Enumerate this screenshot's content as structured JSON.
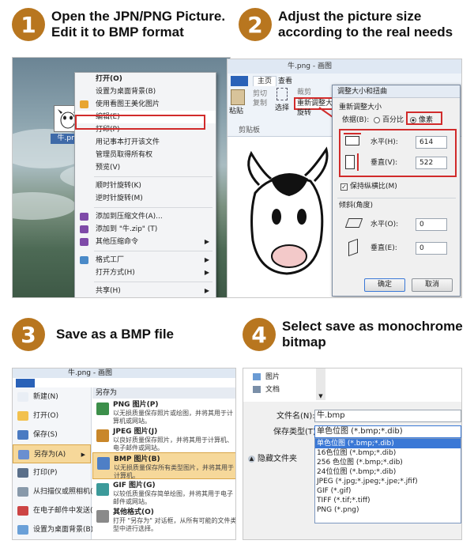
{
  "steps": [
    {
      "number": "1",
      "title_line1": "Open the JPN/PNG Picture.",
      "title_line2": "Edit it to BMP format"
    },
    {
      "number": "2",
      "title_line1": "Adjust the picture size",
      "title_line2": "according to the real needs"
    },
    {
      "number": "3",
      "title_line1": "Save as a BMP file",
      "title_line2": ""
    },
    {
      "number": "4",
      "title_line1": "Select save as monochrome",
      "title_line2": "bitmap"
    }
  ],
  "panel1": {
    "file_label": "牛.png",
    "menu": [
      {
        "label": "打开(O)",
        "bold": true
      },
      {
        "label": "设置为桌面背景(B)"
      },
      {
        "label": "使用看图王美化图片",
        "icon": "#e8a530"
      },
      {
        "label": "编辑(E)",
        "highlight": true
      },
      {
        "label": "打印(P)"
      },
      {
        "label": "用记事本打开该文件"
      },
      {
        "label": "管理员取得所有权"
      },
      {
        "label": "预览(V)"
      },
      {
        "sep": true
      },
      {
        "label": "顺时针旋转(K)"
      },
      {
        "label": "逆时针旋转(M)"
      },
      {
        "sep": true
      },
      {
        "label": "添加到压缩文件(A)...",
        "icon": "#7e4aa8"
      },
      {
        "label": "添加到 \"牛.zip\" (T)",
        "icon": "#7e4aa8"
      },
      {
        "label": "其他压缩命令",
        "icon": "#7e4aa8",
        "arrow": true
      },
      {
        "sep": true
      },
      {
        "label": "格式工厂",
        "icon": "#4a8ac8",
        "arrow": true
      },
      {
        "label": "打开方式(H)",
        "arrow": true
      },
      {
        "sep": true
      },
      {
        "label": "共享(H)",
        "arrow": true
      }
    ]
  },
  "panel2": {
    "window_title": "牛.png - 画图",
    "tab_home": "主页",
    "tab_view": "查看",
    "paste": "粘贴",
    "cut": "剪切",
    "copy": "复制",
    "clipboard": "剪贴板",
    "select": "选择",
    "crop": "裁剪",
    "resize": "重新调整大小",
    "rotate": "旋转",
    "dialog_title": "调整大小和扭曲",
    "resize_group": "重新调整大小",
    "by_label": "依据(B):",
    "percent": "百分比",
    "pixels": "像素",
    "horizontal": "水平(H):",
    "vertical": "垂直(V):",
    "h_value": "614",
    "v_value": "522",
    "keep_ratio": "保持纵横比(M)",
    "skew_group": "倾斜(角度)",
    "skew_h": "水平(O):",
    "skew_v": "垂直(E):",
    "skew_h_value": "0",
    "skew_v_value": "0",
    "ok": "确定",
    "cancel": "取消"
  },
  "panel3": {
    "window_title": "牛.png - 画图",
    "left_items": [
      "新建(N)",
      "打开(O)",
      "保存(S)",
      "另存为(A)",
      "打印(P)",
      "从扫描仪或照相机(M)",
      "在电子邮件中发送(D)",
      "设置为桌面背景(B)"
    ],
    "save_as_header": "另存为",
    "right_items": [
      {
        "title": "PNG 图片(P)",
        "desc": "以无损质量保存照片或绘图，并将其用于计算机或网站。"
      },
      {
        "title": "JPEG 图片(J)",
        "desc": "以良好质量保存照片，并将其用于计算机、电子邮件或网站。"
      },
      {
        "title": "BMP 图片(B)",
        "desc": "以无损质量保存所有类型图片，并将其用于计算机。"
      },
      {
        "title": "GIF 图片(G)",
        "desc": "以较低质量保存简单绘图，并将其用于电子邮件或网站。"
      },
      {
        "title": "其他格式(O)",
        "desc": "打开 \"另存为\" 对话框，从所有可能的文件类型中进行选择。"
      }
    ]
  },
  "panel4": {
    "nav_pictures": "图片",
    "nav_docs": "文档",
    "filename_label": "文件名(N):",
    "filename_value": "牛.bmp",
    "type_label": "保存类型(T):",
    "type_value": "单色位图 (*.bmp;*.dib)",
    "hide_folders": "隐藏文件夹",
    "options": [
      "单色位图 (*.bmp;*.dib)",
      "16色位图 (*.bmp;*.dib)",
      "256 色位图 (*.bmp;*.dib)",
      "24位位图 (*.bmp;*.dib)",
      "JPEG (*.jpg;*.jpeg;*.jpe;*.jfif)",
      "GIF (*.gif)",
      "TIFF (*.tif;*.tiff)",
      "PNG (*.png)"
    ]
  },
  "colors": {
    "badge": "#b8761f",
    "highlight_red": "#d12b2b",
    "selection_blue": "#3a78d6"
  }
}
